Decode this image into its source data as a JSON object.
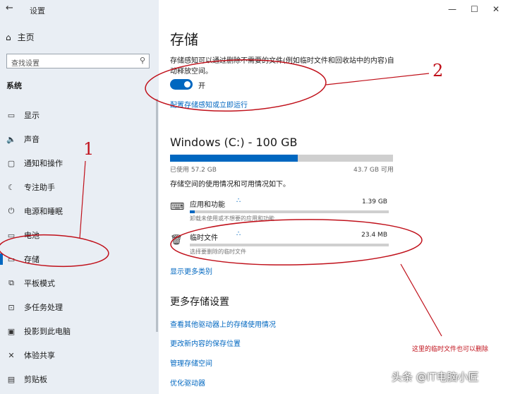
{
  "window": {
    "title": "设置",
    "back_icon": "←",
    "minimize": "—",
    "maximize": "☐",
    "close": "✕"
  },
  "sidebar": {
    "home_label": "主页",
    "search_placeholder": "查找设置",
    "section_label": "系统",
    "items": [
      {
        "label": "显示",
        "icon": "▭"
      },
      {
        "label": "声音",
        "icon": "🔈"
      },
      {
        "label": "通知和操作",
        "icon": "▢"
      },
      {
        "label": "专注助手",
        "icon": "☾"
      },
      {
        "label": "电源和睡眠",
        "icon": "⏻"
      },
      {
        "label": "电池",
        "icon": "▭"
      },
      {
        "label": "存储",
        "icon": "▭"
      },
      {
        "label": "平板模式",
        "icon": "⧉"
      },
      {
        "label": "多任务处理",
        "icon": "⊡"
      },
      {
        "label": "投影到此电脑",
        "icon": "▣"
      },
      {
        "label": "体验共享",
        "icon": "✕"
      },
      {
        "label": "剪贴板",
        "icon": "▤"
      }
    ]
  },
  "main": {
    "title": "存储",
    "storage_sense_desc": "存储感知可以通过删除不需要的文件(例如临时文件和回收站中的内容)自动释放空间。",
    "toggle_state": "开",
    "toggle_on": true,
    "configure_link": "配置存储感知或立即运行",
    "drive_title": "Windows (C:) - 100 GB",
    "drive_used_fraction": 0.572,
    "used_label": "已使用 57.2 GB",
    "available_label": "43.7 GB 可用",
    "usage_desc": "存储空间的使用情况和可用情况如下。",
    "categories": [
      {
        "name": "应用和功能",
        "size": "1.39 GB",
        "desc": "卸载未使用或不想要的应用和功能",
        "fraction": 0.025,
        "icon": "⌨"
      },
      {
        "name": "临时文件",
        "size": "23.4 MB",
        "desc": "选择要删除的临时文件",
        "fraction": 0.0,
        "icon": "🗑"
      }
    ],
    "loading_indicator": "∴",
    "show_more_link": "显示更多类别",
    "more_settings_title": "更多存储设置",
    "more_links": [
      "查看其他驱动器上的存储使用情况",
      "更改新内容的保存位置",
      "管理存储空间",
      "优化驱动器"
    ]
  },
  "annotations": {
    "num1": "1",
    "num2": "2",
    "note": "这里的临时文件也可以删除",
    "color": "#c0101a"
  },
  "watermark": "头条 @IT电脑小匠"
}
